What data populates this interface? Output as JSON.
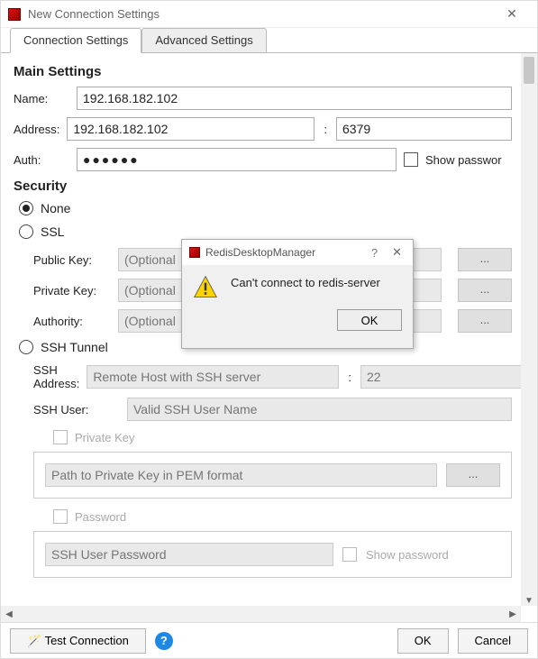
{
  "window": {
    "title": "New Connection Settings"
  },
  "tabs": {
    "active": "Connection Settings",
    "inactive": "Advanced Settings"
  },
  "main": {
    "heading": "Main Settings",
    "name_label": "Name:",
    "name_value": "192.168.182.102",
    "address_label": "Address:",
    "address_value": "192.168.182.102",
    "port_value": "6379",
    "auth_label": "Auth:",
    "auth_mask": "●●●●●●",
    "show_password": "Show passwor"
  },
  "security": {
    "heading": "Security",
    "none": "None",
    "ssl": "SSL",
    "public_key": "Public Key:",
    "private_key": "Private Key:",
    "authority": "Authority:",
    "optional_placeholder": "(Optional",
    "browse": "...",
    "ssh_tunnel": "SSH Tunnel",
    "ssh_address": "SSH Address:",
    "ssh_address_placeholder": "Remote Host with SSH server",
    "ssh_port": "22",
    "ssh_user": "SSH User:",
    "ssh_user_placeholder": "Valid SSH User Name",
    "pkey_check": "Private Key",
    "pkey_placeholder": "Path to Private Key in PEM format",
    "password_check": "Password",
    "password_placeholder": "SSH User Password",
    "show_password_ssh": "Show password"
  },
  "footer": {
    "test": "Test Connection",
    "ok": "OK",
    "cancel": "Cancel"
  },
  "modal": {
    "title": "RedisDesktopManager",
    "message": "Can't connect to redis-server",
    "ok": "OK"
  }
}
